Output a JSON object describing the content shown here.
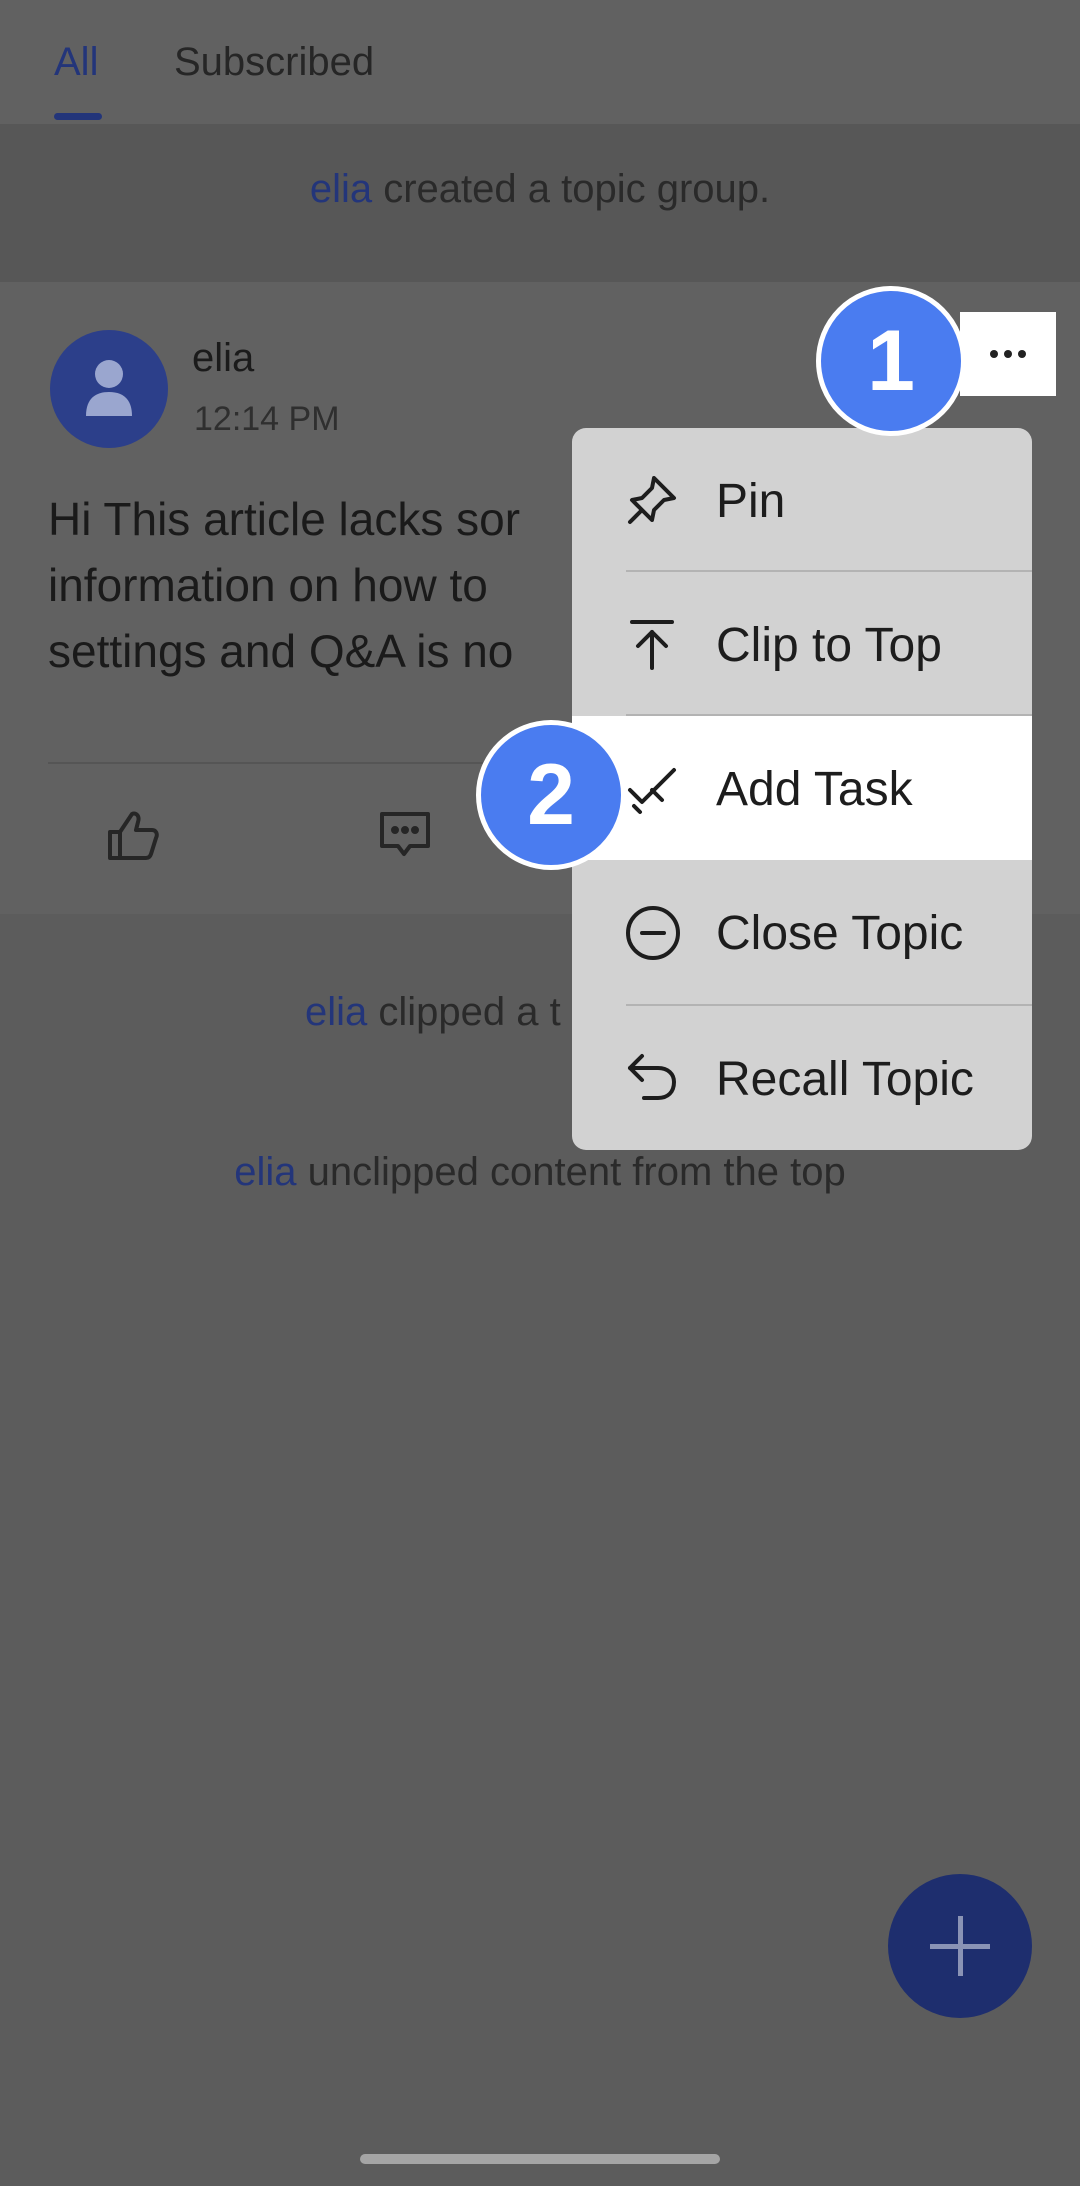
{
  "tabs": {
    "all": "All",
    "subscribed": "Subscribed"
  },
  "system_messages": [
    {
      "name": "elia",
      "text": " created a topic group."
    },
    {
      "name": "elia",
      "text": " clipped a t"
    },
    {
      "name": "elia",
      "text": " unclipped content from the top"
    }
  ],
  "post": {
    "author": "elia",
    "time": "12:14 PM",
    "lines": [
      "Hi This article lacks sor",
      "information on how to",
      "settings and Q&A is no"
    ]
  },
  "menu": {
    "items": [
      {
        "label": "Pin",
        "icon": "pin-icon"
      },
      {
        "label": "Clip to Top",
        "icon": "clip-to-top-icon"
      },
      {
        "label": "Add Task",
        "icon": "add-task-icon"
      },
      {
        "label": "Close Topic",
        "icon": "close-topic-icon"
      },
      {
        "label": "Recall Topic",
        "icon": "recall-icon"
      }
    ],
    "highlighted": "Add Task"
  },
  "callouts": {
    "first": "1",
    "second": "2"
  },
  "colors": {
    "accent": "#4a7cf0",
    "link": "#23357a",
    "fab": "#1e2e6e"
  }
}
